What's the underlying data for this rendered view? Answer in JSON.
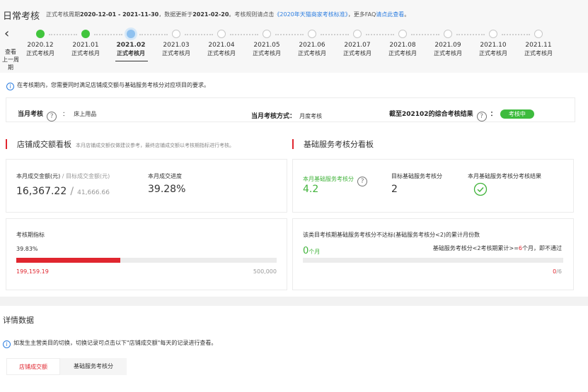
{
  "header": {
    "title": "日常考核",
    "note_prefix": "正式考核周期",
    "period": "2020-12-01 - 2021-11-30",
    "note_mid": "，数据更新于",
    "update_date": "2021-02-20",
    "note_rules": "。考核规则请点击",
    "rules_link": "《2020年天猫商家考核标准》",
    "note_faq": "，更多FAQ",
    "faq_link": "请点此查看",
    "note_end": "。",
    "prev_label_1": "查看",
    "prev_label_2": "上一周期"
  },
  "timeline": [
    {
      "month": "2020.12",
      "sub": "正式考核月",
      "state": "done"
    },
    {
      "month": "2021.01",
      "sub": "正式考核月",
      "state": "done"
    },
    {
      "month": "2021.02",
      "sub": "正式考核月",
      "state": "current"
    },
    {
      "month": "2021.03",
      "sub": "正式考核月",
      "state": "future"
    },
    {
      "month": "2021.04",
      "sub": "正式考核月",
      "state": "future"
    },
    {
      "month": "2021.05",
      "sub": "正式考核月",
      "state": "future"
    },
    {
      "month": "2021.06",
      "sub": "正式考核月",
      "state": "future"
    },
    {
      "month": "2021.07",
      "sub": "正式考核月",
      "state": "future"
    },
    {
      "month": "2021.08",
      "sub": "正式考核月",
      "state": "future"
    },
    {
      "month": "2021.09",
      "sub": "正式考核月",
      "state": "future"
    },
    {
      "month": "2021.10",
      "sub": "正式考核月",
      "state": "future"
    },
    {
      "month": "2021.11",
      "sub": "正式考核月",
      "state": "future"
    }
  ],
  "notice": "在考核期内，您需要同时满足店铺成交额与基础服务考核分对应项目的要求。",
  "summary": {
    "monthly_label": "当月考核",
    "category": "床上用品",
    "method_label": "当月考核方式：",
    "method": "月度考核",
    "result_label": "截至202102的综合考核结果",
    "result_colon": "：",
    "result_badge": "考核中"
  },
  "sales": {
    "title": "店铺成交额看板",
    "note": "本月店铺成交额仅做建议参考，最终店铺成交额以考核期指标进行考核。",
    "amount_label": "本月成交金额(元)",
    "target_label": "/ 目标成交金额(元)",
    "amount": "16,367.22",
    "slash": "/",
    "target": "41,666.66",
    "progress_label": "本月成交进度",
    "progress": "39.28%",
    "period_label": "考核期指标",
    "period_pct": "39.83%",
    "period_value": "199,159.19",
    "period_target": "500,000",
    "period_fraction": 0.3983
  },
  "service": {
    "title": "基础服务考核分看板",
    "score_label": "本月基础服务考核分",
    "score": "4.2",
    "target_label": "目标基础服务考核分",
    "target": "2",
    "result_label": "本月基础服务考核分考核结果",
    "fail_label": "该类目考核期基础服务考核分不达标(基础服务考核分<2)的累计月份数",
    "fail_count": "0",
    "fail_unit": "个月",
    "rule_prefix": "基础服务考核分<2考核期累计>=",
    "rule_num": "6",
    "rule_suffix": "个月，即不通过",
    "count_cur": "0",
    "count_total": "/6"
  },
  "detail": {
    "title": "详情数据",
    "notice": "如发生主营类目的切换，切换记录可点击以下\"店铺成交额\"每天的记录进行查看。",
    "tabs": [
      "店铺成交额",
      "基础服务考核分"
    ]
  },
  "colors": {
    "accent_red": "#e0262f",
    "success_green": "#41b33b",
    "link_blue": "#2d7ee0"
  }
}
